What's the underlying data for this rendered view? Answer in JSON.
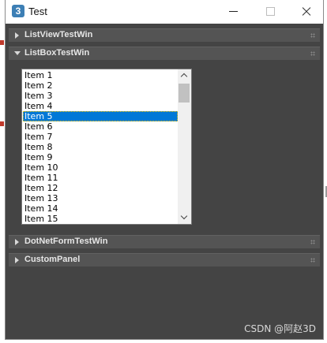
{
  "window": {
    "title": "Test",
    "app_icon_glyph": "3",
    "app_icon_name": "3dsmax-icon"
  },
  "rollouts": [
    {
      "label": "ListViewTestWin",
      "expanded": false
    },
    {
      "label": "ListBoxTestWin",
      "expanded": true
    },
    {
      "label": "DotNetFormTestWin",
      "expanded": false
    },
    {
      "label": "CustomPanel",
      "expanded": false
    }
  ],
  "listbox": {
    "items": [
      "Item 1",
      "Item 2",
      "Item 3",
      "Item 4",
      "Item 5",
      "Item 6",
      "Item 7",
      "Item 8",
      "Item 9",
      "Item 10",
      "Item 11",
      "Item 12",
      "Item 13",
      "Item 14",
      "Item 15"
    ],
    "selected": "Item 5"
  },
  "watermark": "CSDN @阿赵3D",
  "colors": {
    "panel_bg": "#444444",
    "rollout_bg": "#545454",
    "selection": "#0078d7"
  }
}
